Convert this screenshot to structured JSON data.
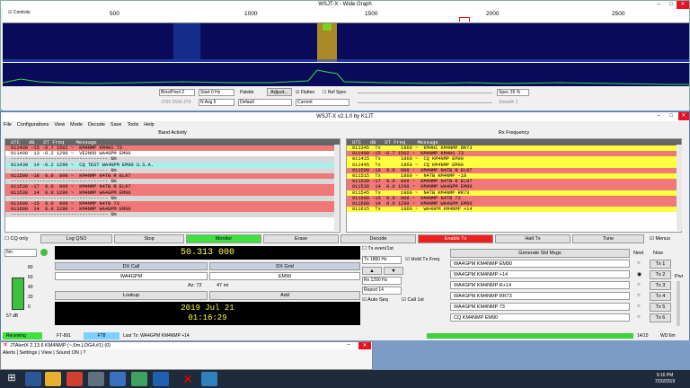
{
  "wide_graph": {
    "title": "WSJT-X - Wide Graph",
    "controls_label": "Controls",
    "scale": [
      "500",
      "1000",
      "1500",
      "2000",
      "2500"
    ],
    "bins": "Bins/Pixel  2",
    "start": "Start 0 Hz",
    "palette": "Palette",
    "adjust": "Adjust...",
    "flatten": "Flatten",
    "ref_spec": "Ref Spec",
    "spec": "Spec 35 %",
    "t_label": "JT65  2500  JT9",
    "n_avg": "N Avg 5",
    "default": "Default",
    "current": "Current",
    "smooth": "Smooth  1"
  },
  "main": {
    "title": "WSJT-X   v2.1.0   by K1JT",
    "menu": [
      "File",
      "Configurations",
      "View",
      "Mode",
      "Decode",
      "Save",
      "Tools",
      "Help"
    ],
    "band_activity": "Band Activity",
    "rx_frequency": "Rx Frequency",
    "col_header": "UTC   dB   DT Freq    Message",
    "band_rows": [
      {
        "t": "011400 -15 -0.7 1502 ~  KM4NMP KM4H1 73",
        "bg": "#f07878"
      },
      {
        "t": "011400  13 -0.2 1290 ~  VE2NOO WA4GPM EM90",
        "bg": "#ffffff"
      },
      {
        "t": "---------------------------------- 6m",
        "bg": "#d8d8d8"
      },
      {
        "t": "011430  14 -0.2 1290 ~  CQ TEST WA4GPM EM90 U.S.A.",
        "bg": "#a8f0f0"
      },
      {
        "t": "---------------------------------- 6m",
        "bg": "#d8d8d8"
      },
      {
        "t": "011500 -18  0.0  808 ~  KM4NMP N4TB R EL97",
        "bg": "#f07878"
      },
      {
        "t": "---------------------------------- 6m",
        "bg": "#d8d8d8"
      },
      {
        "t": "011530 -17  0.0  809 ~  KM4NMP N4TB R EL97",
        "bg": "#f07878"
      },
      {
        "t": "011530  14  0.0 1290 ~  KM4NMP WA4GPM EM90",
        "bg": "#f07878"
      },
      {
        "t": "---------------------------------- 6m",
        "bg": "#d8d8d8"
      },
      {
        "t": "011600 -15  0.0  809 ~  KM4NMP N4TB 73",
        "bg": "#f07878"
      },
      {
        "t": "011600  14  0.0 1290 ~  KM4NMP WA4GPM EM90",
        "bg": "#f07878"
      },
      {
        "t": "---------------------------------- 6m",
        "bg": "#d8d8d8"
      }
    ],
    "rx_rows": [
      {
        "t": "011345  Tx       1860 ~  KM4H1 KM4NMP RR73",
        "bg": "#ffff40"
      },
      {
        "t": "011400 -15 -0.7 1502 ~  KM4NMP KM4H1 73",
        "bg": "#f07878"
      },
      {
        "t": "011415  Tx       1860 ~  CQ KM4NMP EM90",
        "bg": "#ffff40"
      },
      {
        "t": "011445  Tx       1860 ~  CQ KM4NMP EM90",
        "bg": "#ffff40"
      },
      {
        "t": "011500 -18  0.0  808 ~  KM4NMP N4TB R EL97",
        "bg": "#f07878"
      },
      {
        "t": "011515  Tx       1860 ~  N4TB KM4NMP -18",
        "bg": "#ffff40"
      },
      {
        "t": "011530 -17  0.0  809 ~  KM4NMP N4TB R EL97",
        "bg": "#f07878"
      },
      {
        "t": "011530  14  0.0 1290 ~  KM4NMP WA4GPM EM90",
        "bg": "#f07878"
      },
      {
        "t": "011545  Tx       1860 ~  N4TB KM4NMP RR73",
        "bg": "#ffff40"
      },
      {
        "t": "011600 -15  0.0  809 ~  KM4NMP N4TB 73",
        "bg": "#f07878"
      },
      {
        "t": "011600  14  0.0 1290 ~  KM4NMP WA4GPM EM90",
        "bg": "#f07878"
      },
      {
        "t": "011615  Tx       1860 ~  WA4GPM KM4NMP +14",
        "bg": "#ffff40"
      }
    ],
    "buttons": {
      "cq_only": "CQ only",
      "log_qso": "Log QSO",
      "stop": "Stop",
      "monitor": "Monitor",
      "erase": "Erase",
      "decode": "Decode",
      "enable_tx": "Enable Tx",
      "halt_tx": "Halt Tx",
      "tune": "Tune",
      "menus": "Menus"
    },
    "band": "6m",
    "frequency": "50.313 000",
    "dx_call_label": "DX Call",
    "dx_grid_label": "DX Grid",
    "dx_call": "WA4GPM",
    "dx_grid": "EM90",
    "az": "Az: 72",
    "dist": "47 mi",
    "lookup": "Lookup",
    "add": "Add",
    "date": "2019 Jul 21",
    "time": "01:16:29",
    "tx_even": "Tx even/1st",
    "tx_hz": "Tx  1860  Hz",
    "hold_tx": "Hold Tx Freq",
    "rx_hz": "Rx  1290  Hz",
    "report": "Report  14",
    "auto_seq": "Auto Seq",
    "call_1st": "Call 1st",
    "meter_labels": [
      "80",
      "60",
      "40",
      "20",
      "0"
    ],
    "meter_db": "57 dB",
    "gen_std": "Generate Std Msgs",
    "next": "Next",
    "now": "Now",
    "pwr": "Pwr",
    "tx_msgs": [
      "WA4GPM KM4NMP EM90",
      "WA4GPM KM4NMP +14",
      "WA4GPM KM4NMP R+14",
      "WA4GPM KM4NMP RR73",
      "WA4GPM KM4NMP 73",
      "CQ KM4NMP EM90"
    ],
    "tx_btns": [
      "Tx 1",
      "Tx 2",
      "Tx 3",
      "Tx 4",
      "Tx 5",
      "Tx 6"
    ],
    "status": {
      "receiving": "Receiving",
      "mode1": "FT-891",
      "mode2": "FT8",
      "last_tx": "Last Tx: WA4GPM KM4NMP +14",
      "count": "14/15",
      "wd": "WD:6m"
    }
  },
  "jtalert": {
    "title": "JTAlertX 2.13.6 KM4NMP (~,6m,LOG4,#1) (0)",
    "menu": "Alerts | Settings | View | Sound ON | ?"
  },
  "taskbar": {
    "time": "9:16 PM",
    "date": "7/20/2019"
  },
  "colors": {
    "red_row": "#f07878",
    "yellow_row": "#ffff40",
    "cyan_row": "#a8f0f0",
    "monitor_green": "#40e040",
    "enable_tx_red": "#ee2020"
  }
}
